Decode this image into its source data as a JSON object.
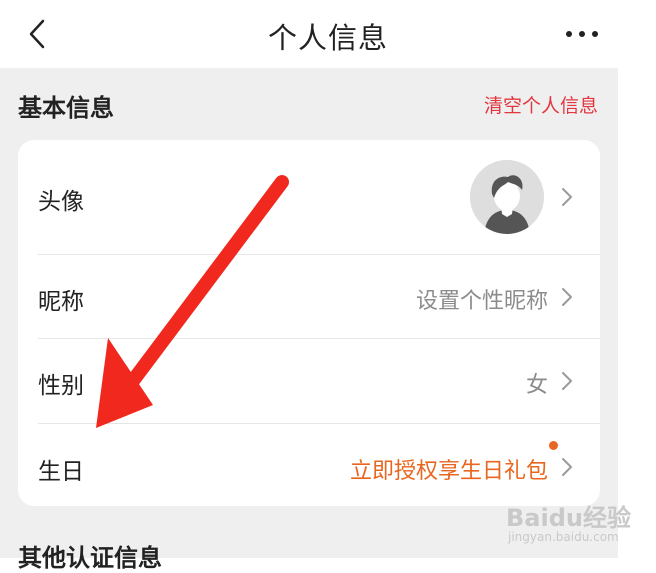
{
  "header": {
    "title": "个人信息"
  },
  "section_basic": {
    "title": "基本信息",
    "clear_label": "清空个人信息"
  },
  "rows": [
    {
      "label": "头像",
      "value": ""
    },
    {
      "label": "昵称",
      "value": "设置个性昵称"
    },
    {
      "label": "性别",
      "value": "女"
    },
    {
      "label": "生日",
      "value": "立即授权享生日礼包"
    }
  ],
  "section_other": {
    "title": "其他认证信息"
  },
  "watermark": {
    "brand": "Baidu经验",
    "url": "jingyan.baidu.com"
  },
  "colors": {
    "accent_red": "#e2373f",
    "accent_orange": "#e8661f",
    "annotation_arrow": "#f0281e"
  },
  "icons": {
    "back": "back-chevron-icon",
    "more": "more-dots-icon",
    "row_chevron": "chevron-right-icon",
    "avatar": "avatar-icon"
  }
}
